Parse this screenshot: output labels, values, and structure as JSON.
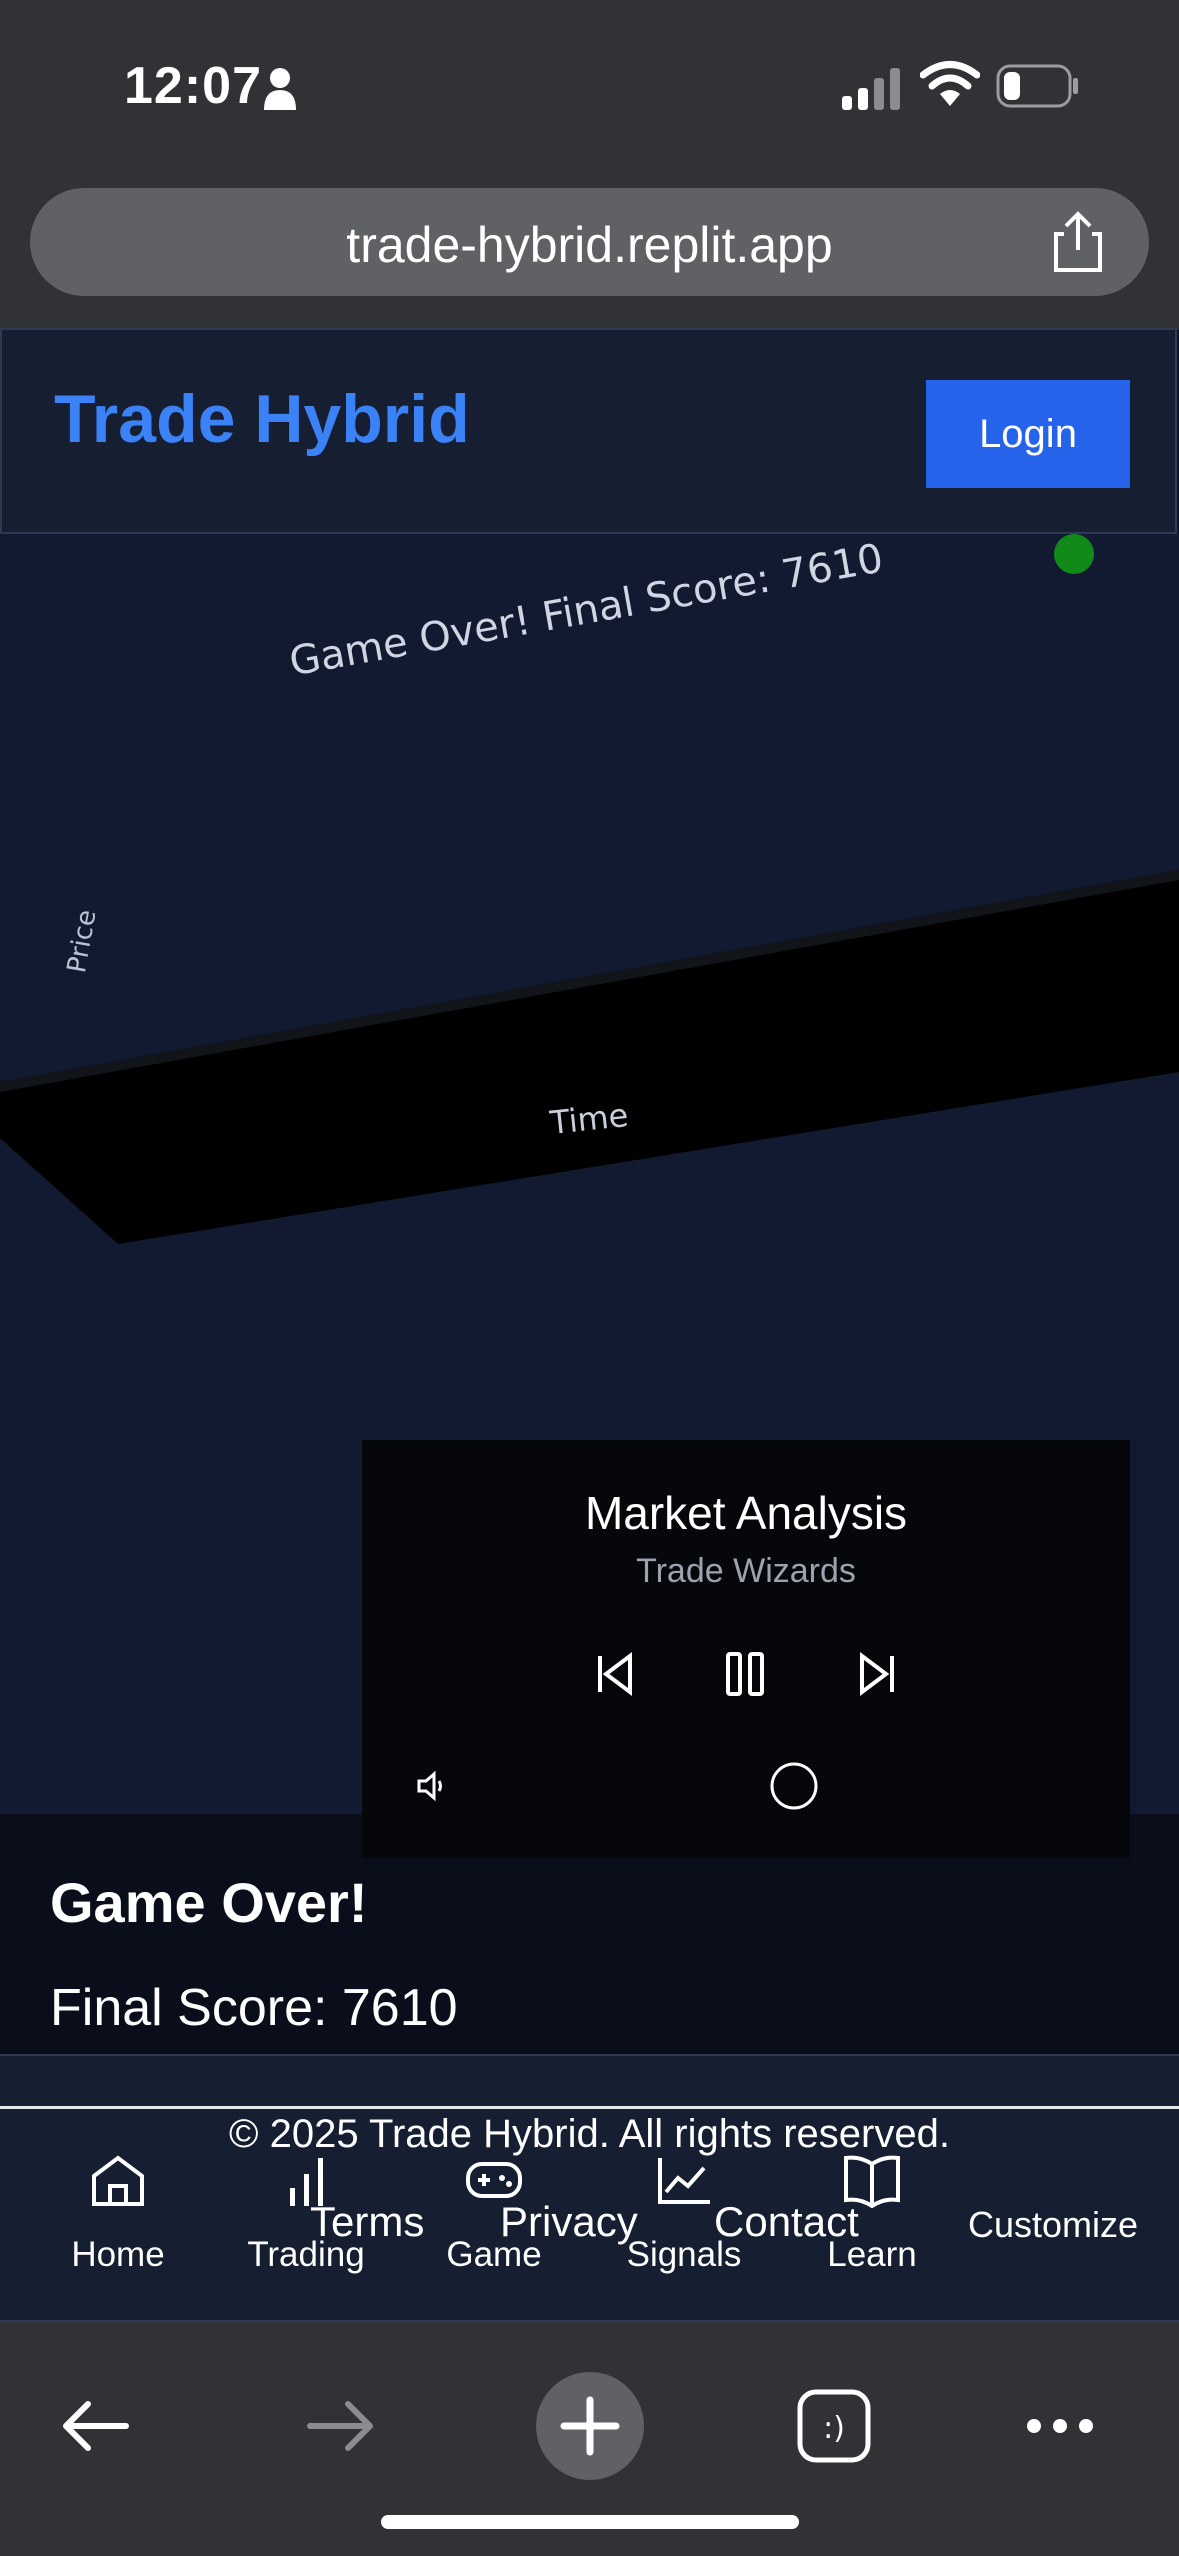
{
  "status_bar": {
    "time": "12:07"
  },
  "browser": {
    "url": "trade-hybrid.replit.app"
  },
  "header": {
    "brand": "Trade Hybrid",
    "login_label": "Login"
  },
  "game": {
    "overlay_text": "Game Over! Final Score: 7610",
    "y_axis_label": "Price",
    "x_axis_label": "Time"
  },
  "player": {
    "title": "Market Analysis",
    "artist": "Trade Wizards"
  },
  "game_over": {
    "title": "Game Over!",
    "score_text": "Final Score: 7610"
  },
  "footer": {
    "copyright": "© 2025 Trade Hybrid. All rights reserved.",
    "nav": [
      {
        "label": "Home",
        "icon": "home-icon"
      },
      {
        "label": "Trading",
        "icon": "bar-chart-icon"
      },
      {
        "label": "Game",
        "icon": "gamepad-icon"
      },
      {
        "label": "Signals",
        "icon": "line-chart-icon"
      },
      {
        "label": "Learn",
        "icon": "book-icon"
      }
    ],
    "links": [
      "Terms",
      "Privacy",
      "Contact"
    ],
    "customize": "Customize"
  }
}
